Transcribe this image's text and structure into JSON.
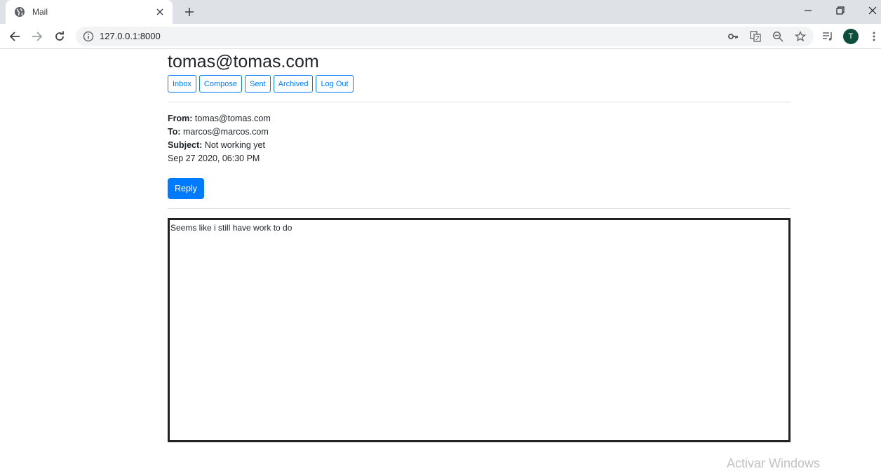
{
  "browser": {
    "tab_title": "Mail",
    "url": "127.0.0.1:8000",
    "profile_initial": "T"
  },
  "mail": {
    "user": "tomas@tomas.com",
    "nav": [
      "Inbox",
      "Compose",
      "Sent",
      "Archived",
      "Log Out"
    ],
    "email": {
      "from_label": "From:",
      "from": "tomas@tomas.com",
      "to_label": "To:",
      "to": "marcos@marcos.com",
      "subject_label": "Subject:",
      "subject": "Not working yet",
      "timestamp": "Sep 27 2020, 06:30 PM",
      "reply_label": "Reply",
      "body": "Seems like i still have work to do"
    }
  },
  "os": {
    "watermark": "Activar Windows"
  },
  "colors": {
    "primary": "#007bff",
    "avatar": "#0d4f3c"
  }
}
